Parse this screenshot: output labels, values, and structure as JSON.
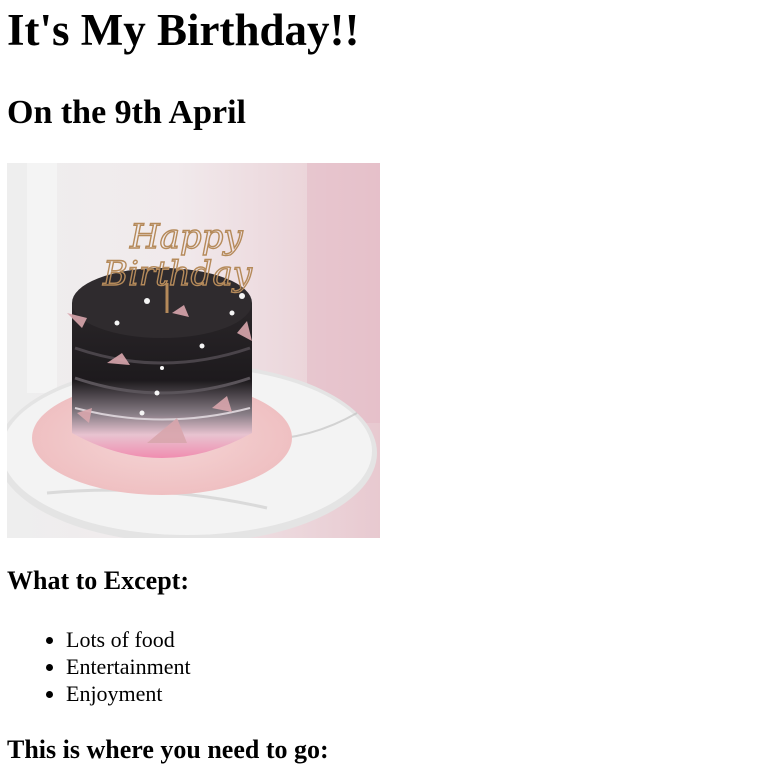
{
  "heading": "It's My Birthday!!",
  "subheading": "On the 9th April",
  "image": {
    "topper_line1": "Happy",
    "topper_line2": "Birthday"
  },
  "expect_heading": "What to Except:",
  "expect_items": [
    "Lots of food",
    "Entertainment",
    "Enjoyment"
  ],
  "directions_heading": "This is where you need to go:"
}
